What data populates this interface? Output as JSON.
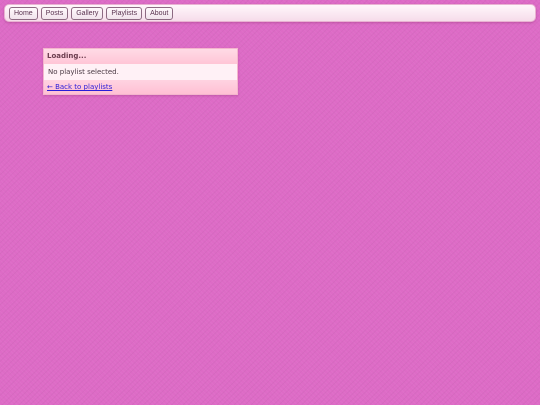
{
  "nav": {
    "items": [
      {
        "label": "Home"
      },
      {
        "label": "Posts"
      },
      {
        "label": "Gallery"
      },
      {
        "label": "Playlists"
      },
      {
        "label": "About"
      }
    ]
  },
  "panel": {
    "title": "Loading...",
    "message": "No playlist selected.",
    "back_link": "← Back to playlists"
  },
  "colors": {
    "background": "#dd6bc6",
    "panel_header": "#ffc5d6",
    "link": "#2a1cd8"
  }
}
